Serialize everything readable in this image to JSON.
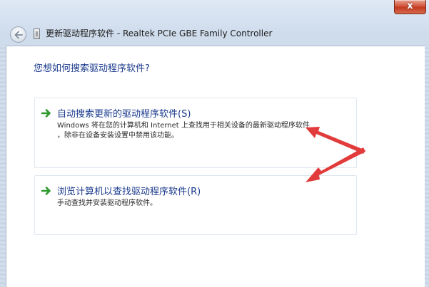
{
  "window": {
    "title": "更新驱动程序软件 - Realtek PCIe GBE Family Controller",
    "close_glyph": "x"
  },
  "main": {
    "question": "您想如何搜索驱动程序软件?",
    "options": [
      {
        "title": "自动搜索更新的驱动程序软件(S)",
        "description_lines": [
          "Windows 将在您的计算机和 Internet 上查找用于相关设备的最新驱动程序软件",
          "，除非在设备安装设置中禁用该功能。"
        ]
      },
      {
        "title": "浏览计算机以查找驱动程序软件(R)",
        "description_lines": [
          "手动查找并安装驱动程序软件。"
        ]
      }
    ]
  },
  "icons": {
    "back": "back-arrow-icon",
    "device": "device-icon",
    "option_arrow": "green-arrow-icon"
  },
  "colors": {
    "link_blue": "#1a3a8c",
    "green_arrow": "#2e9a2e",
    "annotation_red": "#e23b3b",
    "close_red": "#c23b1f"
  }
}
